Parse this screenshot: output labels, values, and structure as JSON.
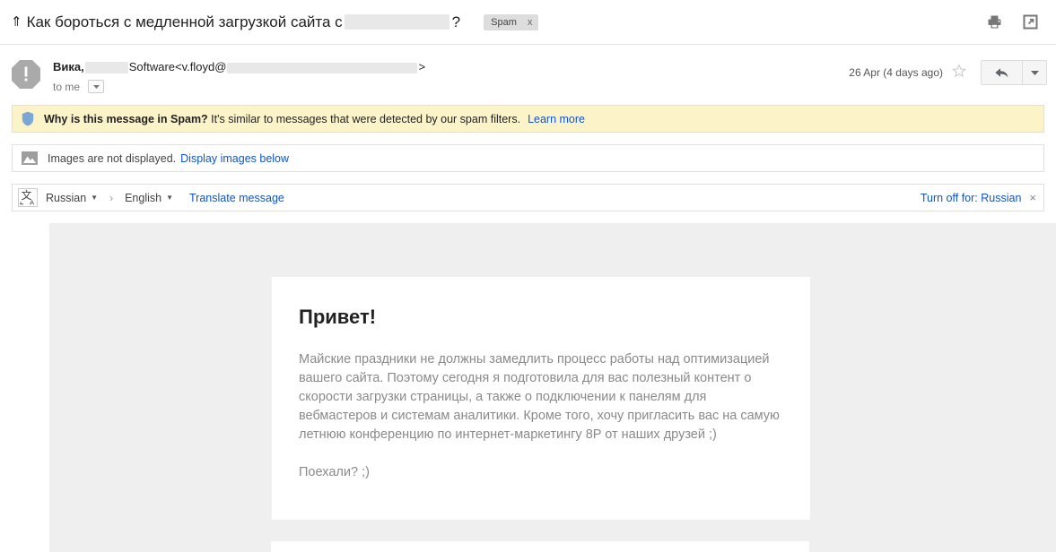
{
  "subject": {
    "collapse_icon": "up-arrow-icon",
    "text_before_redaction": "Как бороться с медленной загрузкой сайта с",
    "redacted_placeholder": "",
    "question_mark": "?",
    "label_chip": "Spam",
    "label_chip_remove": "x"
  },
  "subject_actions": {
    "print_icon": "print-icon",
    "popout_icon": "open-in-new-window-icon"
  },
  "sender": {
    "avatar_icon": "spam-warning-octagon-icon",
    "name": "Вика,",
    "company": "Software",
    "email_prefix": "<v.floyd@",
    "email_suffix": ">",
    "recipient": "to me",
    "details_caret": "▾",
    "date": "26 Apr (4 days ago)",
    "star_icon": "star-icon",
    "reply_icon": "reply-arrow-icon",
    "more_caret": "▾"
  },
  "spam_banner": {
    "icon": "shield-icon",
    "question": "Why is this message in Spam?",
    "explanation": " It's similar to messages that were detected by our spam filters.",
    "learn_more": "Learn more"
  },
  "images_bar": {
    "icon": "image-placeholder-icon",
    "text": "Images are not displayed.",
    "link": "Display images below"
  },
  "translate_bar": {
    "icon": "translate-icon",
    "source_language": "Russian",
    "arrow": "›",
    "target_language": "English",
    "translate_action": "Translate message",
    "turn_off": "Turn off for: Russian",
    "close": "×"
  },
  "message_body": {
    "greeting": "Привет!",
    "paragraph_1": "Майские праздники не должны замедлить процесс работы над оптимизацией вашего сайта. Поэтому сегодня я подготовила для вас полезный контент о скорости загрузки страницы, а также о подключении к панелям для вебмастеров и системам аналитики. Кроме того, хочу пригласить вас на самую летнюю конференцию по интернет-маркетингу 8P от наших друзей ;)",
    "paragraph_2": "Поехали? ;)"
  },
  "colors": {
    "link": "#1155cc",
    "spam_banner_bg": "#fcf4c8",
    "body_bg": "#efefef",
    "body_text": "#8a8a8a"
  }
}
